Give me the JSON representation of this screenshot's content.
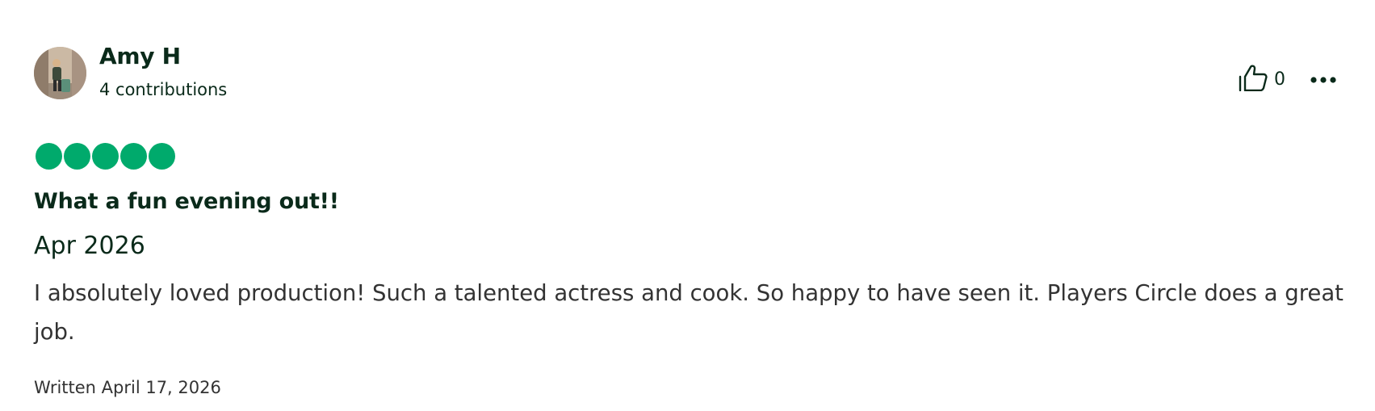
{
  "review": {
    "author": {
      "name": "Amy H",
      "contributions": "4 contributions",
      "avatar_icon": "user-avatar-photo"
    },
    "helpful": {
      "icon": "thumbs-up-icon",
      "count": "0"
    },
    "more_icon": "more-options-icon",
    "rating": {
      "value": 5,
      "max": 5,
      "color": "#00aa6c"
    },
    "title": "What a fun evening out!!",
    "visit_date": "Apr 2026",
    "body": "I absolutely loved production! Such a talented actress and cook. So happy to have seen it. Players Circle does a great job.",
    "written": "Written April 17, 2026"
  },
  "colors": {
    "text_primary": "#0a2a1a",
    "text_secondary": "#333333",
    "accent": "#00aa6c"
  }
}
